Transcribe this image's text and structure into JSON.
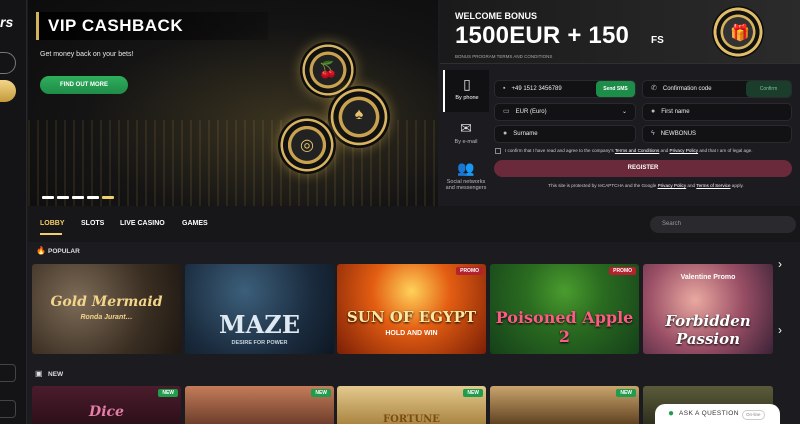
{
  "rail": {
    "logo": "rs"
  },
  "hero": {
    "title": "VIP CASHBACK",
    "subtitle": "Get money back on your bets!",
    "cta": "FIND OUT MORE",
    "slides": 5,
    "active_slide": 5
  },
  "bonus": {
    "label": "WELCOME BONUS",
    "amount": "1500EUR + 150",
    "fs": "FS",
    "terms": "BONUS PROGRAM TERMS AND CONDITIONS"
  },
  "register_tabs": [
    {
      "label": "By phone",
      "icon": "phone-icon"
    },
    {
      "label": "By e-mail",
      "icon": "envelope-icon"
    },
    {
      "label": "Social networks and messengers",
      "icon": "people-icon"
    }
  ],
  "form": {
    "phone_value": "+49   1512 3456789",
    "send_sms": "Send SMS",
    "code_placeholder": "Confirmation code",
    "confirm": "Confirm",
    "currency": "EUR (Euro)",
    "first_name": "First name",
    "surname": "Surname",
    "promo": "NEWBONUS",
    "agree_1": "I confirm that I have read and agree to the company's ",
    "agree_terms": "Terms and Conditions",
    "agree_and": " and ",
    "agree_privacy": "Privacy Policy",
    "agree_2": " and that I am of legal age.",
    "register": "REGISTER",
    "captcha_1": "This site is protected by reCAPTCHA and the Google ",
    "captcha_privacy": "Privacy Policy",
    "captcha_and": " and ",
    "captcha_terms": "Terms of Service",
    "captcha_2": " apply."
  },
  "nav": {
    "lobby": "LOBBY",
    "slots": "SLOTS",
    "live": "LIVE CASINO",
    "games": "GAMES",
    "search_placeholder": "Search"
  },
  "sections": {
    "popular": "POPULAR",
    "new": "NEW"
  },
  "popular_games": [
    {
      "title": "Gold Mermaid",
      "sub": "Ronda Jurant…"
    },
    {
      "title": "MAZE",
      "sub": "DESIRE FOR POWER"
    },
    {
      "title": "SUN OF EGYPT",
      "sub": "HOLD AND WIN",
      "badge": "PROMO"
    },
    {
      "title": "Poisoned Apple 2",
      "sub": "",
      "badge": "PROMO"
    },
    {
      "title": "Forbidden Passion",
      "sub": "Valentine Promo"
    }
  ],
  "new_games": [
    {
      "title": "Dice",
      "badge": "NEW"
    },
    {
      "title": "",
      "badge": "NEW"
    },
    {
      "title": "FORTUNE",
      "badge": "NEW"
    },
    {
      "title": "",
      "badge": "NEW"
    },
    {
      "title": "",
      "badge": ""
    }
  ],
  "chat": {
    "label": "ASK A QUESTION",
    "status": "On-line"
  },
  "colors": {
    "accent": "#f2cf6a",
    "green": "#1f9c4c",
    "register": "#6b2a3b"
  }
}
